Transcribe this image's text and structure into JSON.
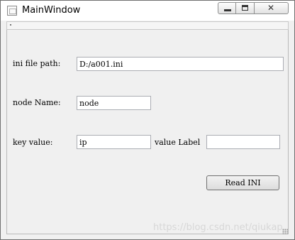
{
  "window": {
    "title": "MainWindow",
    "controls": {
      "minimize_icon": "minimize-icon",
      "maximize_icon": "maximize-icon",
      "close_glyph": "✕"
    }
  },
  "form": {
    "ini_path": {
      "label": "ini file path:",
      "value": "D:/a001.ini"
    },
    "node_name": {
      "label": "node Name:",
      "value": "node"
    },
    "key_value": {
      "label": "key value:",
      "value": "ip"
    },
    "value_label": {
      "label": "value Label",
      "value": ""
    },
    "read_button": {
      "label": "Read INI"
    }
  },
  "watermark": "https://blog.csdn.net/qiukap"
}
